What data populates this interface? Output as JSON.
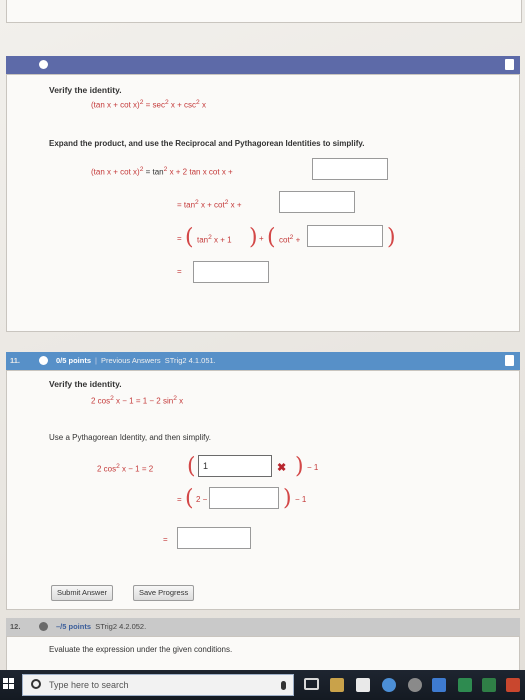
{
  "q10": {
    "verify_label": "Verify the identity.",
    "identity_lhs": "(tan x + cot x)",
    "identity_exp": "2",
    "identity_rhs_a": " = sec",
    "identity_rhs_b": " x + csc",
    "identity_rhs_c": " x",
    "instruction": "Expand the product, and use the Reciprocal and Pythagorean Identities to simplify.",
    "line1_lhs": "(tan x + cot x)",
    "line1_eq": " = tan",
    "line1_mid": " x + 2 tan x cot x +",
    "line2": "= tan",
    "line2_mid": " x + cot",
    "line2_end": " x +",
    "line3_a": "tan",
    "line3_b": " x + 1",
    "line3_plus": "+",
    "line3_c": "cot",
    "line3_d": " +",
    "line4_eq": "=",
    "sq": "2"
  },
  "q11": {
    "number": "11.",
    "points": "0/5 points",
    "separator": "|",
    "previous": "Previous Answers",
    "code": "STrig2 4.1.051.",
    "verify_label": "Verify the identity.",
    "identity_a": "2 cos",
    "identity_b": " x − 1 = 1 − 2 sin",
    "identity_c": " x",
    "instruction": "Use a Pythagorean Identity, and then simplify.",
    "line1_a": "2 cos",
    "line1_b": " x − 1 = 2",
    "line1_input_value": "1",
    "line1_end": "− 1",
    "line2_eq": "=",
    "line2_a": "2 −",
    "line2_end": "− 1",
    "line3_eq": "=",
    "sq": "2",
    "submit_label": "Submit Answer",
    "save_label": "Save Progress"
  },
  "q12": {
    "number": "12.",
    "points": "–/5 points",
    "code": "STrig2 4.2.052.",
    "instruction": "Evaluate the expression under the given conditions."
  },
  "taskbar": {
    "search_placeholder": "Type here to search"
  }
}
